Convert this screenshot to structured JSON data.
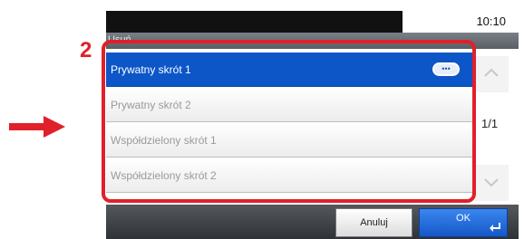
{
  "annotation": {
    "step_number": "2",
    "arrow_icon": "right-arrow-icon",
    "accent_color": "#e0202a"
  },
  "status": {
    "time": "10:10"
  },
  "header": {
    "title": "Usuń"
  },
  "list": {
    "items": [
      {
        "label": "Prywatny skrót 1",
        "selected": true
      },
      {
        "label": "Prywatny skrót 2",
        "selected": false
      },
      {
        "label": "Współdzielony skrót 1",
        "selected": false
      },
      {
        "label": "Współdzielony skrót 2",
        "selected": false
      }
    ],
    "more_icon": "ellipsis-icon"
  },
  "pager": {
    "indicator": "1/1",
    "up_icon": "chevron-up-icon",
    "down_icon": "chevron-down-icon"
  },
  "footer": {
    "cancel_label": "Anuluj",
    "ok_label": "OK",
    "enter_icon": "enter-icon"
  },
  "colors": {
    "selection": "#0c56c8",
    "ok_button": "#1558c8"
  }
}
